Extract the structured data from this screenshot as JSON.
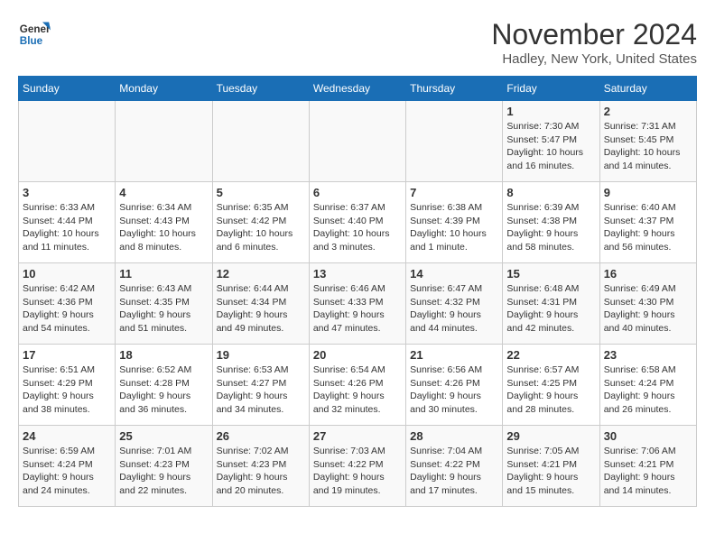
{
  "logo": {
    "line1": "General",
    "line2": "Blue"
  },
  "title": "November 2024",
  "location": "Hadley, New York, United States",
  "headers": [
    "Sunday",
    "Monday",
    "Tuesday",
    "Wednesday",
    "Thursday",
    "Friday",
    "Saturday"
  ],
  "weeks": [
    [
      {
        "day": "",
        "info": ""
      },
      {
        "day": "",
        "info": ""
      },
      {
        "day": "",
        "info": ""
      },
      {
        "day": "",
        "info": ""
      },
      {
        "day": "",
        "info": ""
      },
      {
        "day": "1",
        "info": "Sunrise: 7:30 AM\nSunset: 5:47 PM\nDaylight: 10 hours and 16 minutes."
      },
      {
        "day": "2",
        "info": "Sunrise: 7:31 AM\nSunset: 5:45 PM\nDaylight: 10 hours and 14 minutes."
      }
    ],
    [
      {
        "day": "3",
        "info": "Sunrise: 6:33 AM\nSunset: 4:44 PM\nDaylight: 10 hours and 11 minutes."
      },
      {
        "day": "4",
        "info": "Sunrise: 6:34 AM\nSunset: 4:43 PM\nDaylight: 10 hours and 8 minutes."
      },
      {
        "day": "5",
        "info": "Sunrise: 6:35 AM\nSunset: 4:42 PM\nDaylight: 10 hours and 6 minutes."
      },
      {
        "day": "6",
        "info": "Sunrise: 6:37 AM\nSunset: 4:40 PM\nDaylight: 10 hours and 3 minutes."
      },
      {
        "day": "7",
        "info": "Sunrise: 6:38 AM\nSunset: 4:39 PM\nDaylight: 10 hours and 1 minute."
      },
      {
        "day": "8",
        "info": "Sunrise: 6:39 AM\nSunset: 4:38 PM\nDaylight: 9 hours and 58 minutes."
      },
      {
        "day": "9",
        "info": "Sunrise: 6:40 AM\nSunset: 4:37 PM\nDaylight: 9 hours and 56 minutes."
      }
    ],
    [
      {
        "day": "10",
        "info": "Sunrise: 6:42 AM\nSunset: 4:36 PM\nDaylight: 9 hours and 54 minutes."
      },
      {
        "day": "11",
        "info": "Sunrise: 6:43 AM\nSunset: 4:35 PM\nDaylight: 9 hours and 51 minutes."
      },
      {
        "day": "12",
        "info": "Sunrise: 6:44 AM\nSunset: 4:34 PM\nDaylight: 9 hours and 49 minutes."
      },
      {
        "day": "13",
        "info": "Sunrise: 6:46 AM\nSunset: 4:33 PM\nDaylight: 9 hours and 47 minutes."
      },
      {
        "day": "14",
        "info": "Sunrise: 6:47 AM\nSunset: 4:32 PM\nDaylight: 9 hours and 44 minutes."
      },
      {
        "day": "15",
        "info": "Sunrise: 6:48 AM\nSunset: 4:31 PM\nDaylight: 9 hours and 42 minutes."
      },
      {
        "day": "16",
        "info": "Sunrise: 6:49 AM\nSunset: 4:30 PM\nDaylight: 9 hours and 40 minutes."
      }
    ],
    [
      {
        "day": "17",
        "info": "Sunrise: 6:51 AM\nSunset: 4:29 PM\nDaylight: 9 hours and 38 minutes."
      },
      {
        "day": "18",
        "info": "Sunrise: 6:52 AM\nSunset: 4:28 PM\nDaylight: 9 hours and 36 minutes."
      },
      {
        "day": "19",
        "info": "Sunrise: 6:53 AM\nSunset: 4:27 PM\nDaylight: 9 hours and 34 minutes."
      },
      {
        "day": "20",
        "info": "Sunrise: 6:54 AM\nSunset: 4:26 PM\nDaylight: 9 hours and 32 minutes."
      },
      {
        "day": "21",
        "info": "Sunrise: 6:56 AM\nSunset: 4:26 PM\nDaylight: 9 hours and 30 minutes."
      },
      {
        "day": "22",
        "info": "Sunrise: 6:57 AM\nSunset: 4:25 PM\nDaylight: 9 hours and 28 minutes."
      },
      {
        "day": "23",
        "info": "Sunrise: 6:58 AM\nSunset: 4:24 PM\nDaylight: 9 hours and 26 minutes."
      }
    ],
    [
      {
        "day": "24",
        "info": "Sunrise: 6:59 AM\nSunset: 4:24 PM\nDaylight: 9 hours and 24 minutes."
      },
      {
        "day": "25",
        "info": "Sunrise: 7:01 AM\nSunset: 4:23 PM\nDaylight: 9 hours and 22 minutes."
      },
      {
        "day": "26",
        "info": "Sunrise: 7:02 AM\nSunset: 4:23 PM\nDaylight: 9 hours and 20 minutes."
      },
      {
        "day": "27",
        "info": "Sunrise: 7:03 AM\nSunset: 4:22 PM\nDaylight: 9 hours and 19 minutes."
      },
      {
        "day": "28",
        "info": "Sunrise: 7:04 AM\nSunset: 4:22 PM\nDaylight: 9 hours and 17 minutes."
      },
      {
        "day": "29",
        "info": "Sunrise: 7:05 AM\nSunset: 4:21 PM\nDaylight: 9 hours and 15 minutes."
      },
      {
        "day": "30",
        "info": "Sunrise: 7:06 AM\nSunset: 4:21 PM\nDaylight: 9 hours and 14 minutes."
      }
    ]
  ]
}
